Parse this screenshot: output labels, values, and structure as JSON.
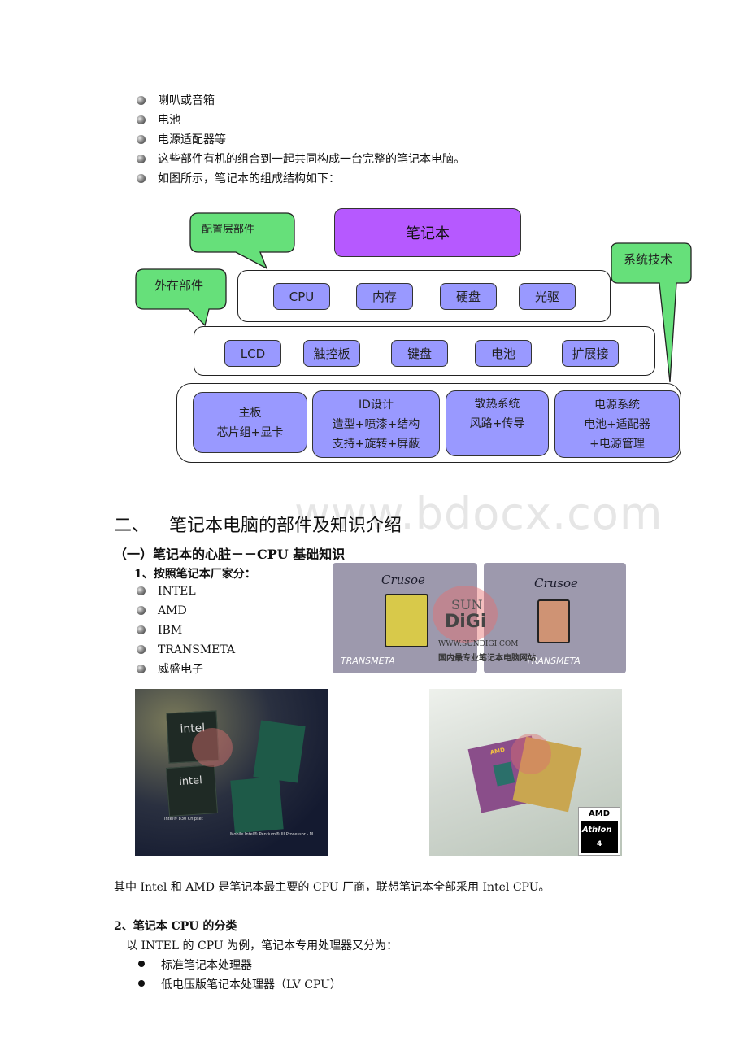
{
  "top_bullets": [
    "喇叭或音箱",
    "电池",
    "电源适配器等",
    "这些部件有机的组合到一起共同构成一台完整的笔记本电脑。",
    "如图所示，笔记本的组成结构如下："
  ],
  "diagram": {
    "root": "笔记本",
    "callouts": {
      "config": "配置层部件",
      "external": "外在部件",
      "system": "系统技术"
    },
    "layer1": [
      "CPU",
      "内存",
      "硬盘",
      "光驱"
    ],
    "layer2": [
      "LCD",
      "触控板",
      "键盘",
      "电池",
      "扩展接"
    ],
    "layer3": [
      {
        "title": "主板",
        "lines": [
          "芯片组+显卡"
        ]
      },
      {
        "title": "ID设计",
        "lines": [
          "造型+喷漆+结构",
          "支持+旋转+屏蔽"
        ]
      },
      {
        "title": "散热系统",
        "lines": [
          "风路+传导"
        ]
      },
      {
        "title": "电源系统",
        "lines": [
          "电池+适配器",
          "+电源管理"
        ]
      }
    ],
    "colors": {
      "root": "#b659ff",
      "box": "#9999ff",
      "callout": "#66e07a"
    }
  },
  "watermark": "www.bdocx.com",
  "section2": {
    "heading_num": "二、",
    "heading": "笔记本电脑的部件及知识介绍",
    "sub1": "（一）笔记本的心脏－－CPU 基础知识",
    "item1": "1、按照笔记本厂家分：",
    "vendors": [
      "INTEL",
      "AMD",
      "IBM",
      "TRANSMETA",
      "威盛电子"
    ]
  },
  "images": {
    "transmeta": {
      "brand": "Crusoe",
      "logo": "TRANSMETA",
      "watermark_brand": "SUN DiGi",
      "watermark_url": "WWW.SUNDIGI.COM",
      "watermark_slogan": "国内最专业笔记本电脑网站"
    },
    "intel": {
      "caption1": "Intel® 830 Chipset",
      "caption2": "Mobile Intel® Pentium® III Processor - M",
      "chip_label": "intel"
    },
    "amd": {
      "logo": "AMD",
      "product": "Athlon",
      "version": "4"
    }
  },
  "summary": "其中 Intel 和 AMD 是笔记本最主要的 CPU 厂商，联想笔记本全部采用 Intel CPU。",
  "section_cpu_class": {
    "title": "2、笔记本 CPU 的分类",
    "intro": "以 INTEL 的 CPU 为例，笔记本专用处理器又分为：",
    "items": [
      "标准笔记本处理器",
      "低电压版笔记本处理器（LV CPU）"
    ]
  }
}
